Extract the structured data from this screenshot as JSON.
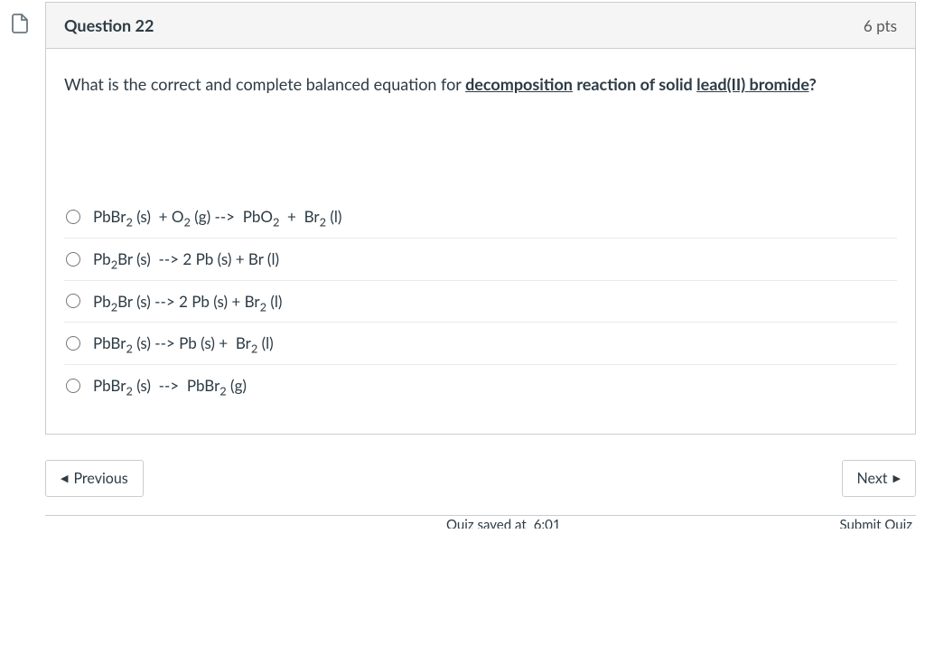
{
  "question": {
    "number_label": "Question 22",
    "points_label": "6 pts",
    "prompt_plain": "What is the correct and complete balanced equation for decomposition reaction of solid lead(II) bromide?"
  },
  "options": [
    {
      "plain": "PbBr2 (s)  + O2 (g) --> PbO2 + Br2 (l)"
    },
    {
      "plain": "Pb2Br (s)  --> 2 Pb (s) + Br (l)"
    },
    {
      "plain": "Pb2Br (s) --> 2 Pb (s) + Br2 (l)"
    },
    {
      "plain": "PbBr2 (s) --> Pb (s) + Br2 (l)"
    },
    {
      "plain": "PbBr2 (s) -->  PbBr2 (g)"
    }
  ],
  "nav": {
    "previous": "Previous",
    "next": "Next"
  },
  "footer": {
    "saved_prefix": "Quiz saved at",
    "saved_time": "6:01",
    "submit": "Submit Quiz"
  }
}
